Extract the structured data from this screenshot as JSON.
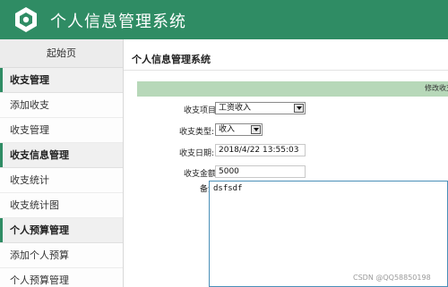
{
  "header": {
    "title": "个人信息管理系统"
  },
  "sidebar": {
    "home": "起始页",
    "groups": [
      {
        "label": "收支管理",
        "items": [
          "添加收支",
          "收支管理"
        ]
      },
      {
        "label": "收支信息管理",
        "items": [
          "收支统计",
          "收支统计图"
        ]
      },
      {
        "label": "个人预算管理",
        "items": [
          "添加个人预算",
          "个人预算管理"
        ]
      }
    ]
  },
  "main": {
    "title": "个人信息管理系统",
    "panel_label": "修改收支",
    "form": {
      "item_label": "收支项目",
      "item_value": "工资收入",
      "type_label": "收支类型:",
      "type_value": "收入",
      "date_label": "收支日期:",
      "date_value": "2018/4/22 13:55:03",
      "amount_label": "收支金额",
      "amount_value": "5000",
      "note_label": "备注",
      "note_value": "dsfsdf"
    }
  },
  "watermark": "CSDN @QQ58850198",
  "colors": {
    "header_bg": "#2f8c64",
    "panel_bar": "#b7d8b9",
    "accent": "#2f8c64"
  }
}
